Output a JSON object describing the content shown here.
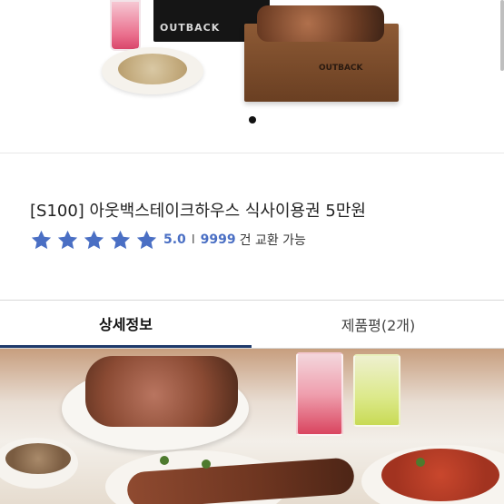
{
  "carousel": {
    "brand_text": "OUTBACK",
    "active_dot_index": 0,
    "dot_color": "#111111"
  },
  "product": {
    "title": "[S100] 아웃백스테이크하우스 식사이용권 5만원",
    "rating": {
      "stars": 5,
      "score": "5.0",
      "separator": "I",
      "count": "9999",
      "count_label": "건 교환 가능",
      "star_color": "#4a6fc4"
    }
  },
  "tabs": {
    "items": [
      {
        "label": "상세정보",
        "active": true
      },
      {
        "label": "제품평(2개)",
        "active": false
      }
    ],
    "active_underline_color": "#1f3a6b"
  },
  "icons": {
    "star": "star-icon"
  }
}
